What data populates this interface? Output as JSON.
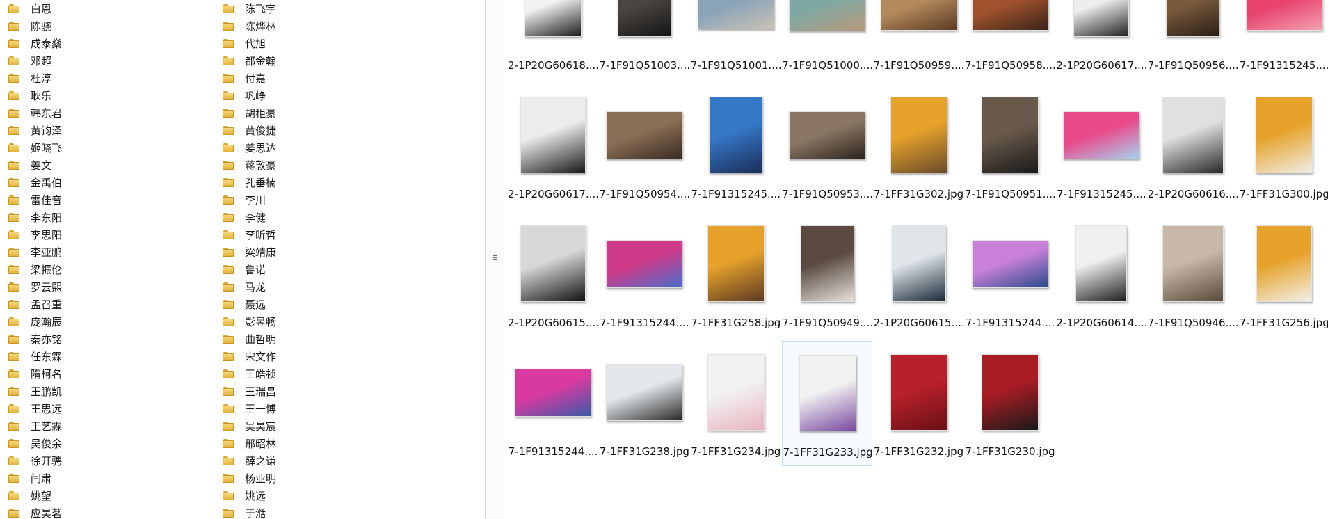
{
  "folders_col1": [
    "白恩",
    "陈骁",
    "成泰燊",
    "邓超",
    "杜淳",
    "耿乐",
    "韩东君",
    "黄钧泽",
    "姬晓飞",
    "姜文",
    "金禹伯",
    "雷佳音",
    "李东阳",
    "李思阳",
    "李亚鹏",
    "梁振伦",
    "罗云熙",
    "孟召重",
    "庞瀚辰",
    "秦亦铭",
    "任东霖",
    "隋柯名",
    "王鹏凯",
    "王思远",
    "王艺霖",
    "吴俊余",
    "徐开骋",
    "闫肃",
    "姚望",
    "应昊茗"
  ],
  "folders_col2": [
    "陈飞宇",
    "陈烨林",
    "代旭",
    "都金翰",
    "付嘉",
    "巩峥",
    "胡秬豪",
    "黄俊捷",
    "姜思达",
    "蒋敦豪",
    "孔垂楠",
    "李川",
    "李健",
    "李昕哲",
    "梁靖康",
    "鲁诺",
    "马龙",
    "聂远",
    "彭昱畅",
    "曲哲明",
    "宋文作",
    "王皓祯",
    "王瑞昌",
    "王一博",
    "吴昊宸",
    "邢昭林",
    "薛之谦",
    "杨业明",
    "姚远",
    "于湉"
  ],
  "files": [
    {
      "name": "2-1P20G60618....",
      "colors": [
        "#f2f2f2",
        "#1c1c1c"
      ]
    },
    {
      "name": "7-1F91Q51003....",
      "colors": [
        "#4a4540",
        "#151515"
      ]
    },
    {
      "name": "7-1F91Q51001....",
      "colors": [
        "#8aa3b8",
        "#c9c2b6"
      ]
    },
    {
      "name": "7-1F91Q51000....",
      "colors": [
        "#7fa8a3",
        "#b79a7c"
      ]
    },
    {
      "name": "7-1F91Q50959....",
      "colors": [
        "#b38a5c",
        "#5c3a24"
      ]
    },
    {
      "name": "7-1F91Q50958....",
      "colors": [
        "#a0522d",
        "#3a2418"
      ]
    },
    {
      "name": "2-1P20G60617....",
      "colors": [
        "#eeeeee",
        "#222222"
      ]
    },
    {
      "name": "7-1F91Q50956....",
      "colors": [
        "#7a5a3c",
        "#2a1e16"
      ]
    },
    {
      "name": "7-1F91315245....",
      "colors": [
        "#e8446e",
        "#f4a0b0"
      ]
    },
    {
      "name": "2-1P20G60617....",
      "colors": [
        "#ececec",
        "#1a1a1a"
      ]
    },
    {
      "name": "7-1F91Q50954....",
      "colors": [
        "#8a6e55",
        "#3a2b22"
      ]
    },
    {
      "name": "7-1F91315245....",
      "colors": [
        "#3578c8",
        "#1c2e5a"
      ]
    },
    {
      "name": "7-1F91Q50953....",
      "colors": [
        "#8a7663",
        "#2d241e"
      ]
    },
    {
      "name": "7-1FF31G302.jpg",
      "colors": [
        "#e6a22a",
        "#6b4c2a"
      ]
    },
    {
      "name": "7-1F91Q50951....",
      "colors": [
        "#6a5a4c",
        "#1a1a1a"
      ]
    },
    {
      "name": "7-1F91315245....",
      "colors": [
        "#e84a8a",
        "#a7d2f0"
      ]
    },
    {
      "name": "2-1P20G60616....",
      "colors": [
        "#e0e0e0",
        "#2a2a2a"
      ]
    },
    {
      "name": "7-1FF31G300.jpg",
      "colors": [
        "#e6a22a",
        "#f2ece4"
      ]
    },
    {
      "name": "2-1P20G60615....",
      "colors": [
        "#d8d8d8",
        "#111111"
      ]
    },
    {
      "name": "7-1F91315244....",
      "colors": [
        "#d03a8a",
        "#4a6ec8"
      ]
    },
    {
      "name": "7-1FF31G258.jpg",
      "colors": [
        "#e6a22a",
        "#5c3a24"
      ]
    },
    {
      "name": "7-1F91Q50949....",
      "colors": [
        "#5a4a40",
        "#e6e2dc"
      ]
    },
    {
      "name": "2-1P20G60615....",
      "colors": [
        "#dfe5e8",
        "#1a2a3a"
      ]
    },
    {
      "name": "7-1F91315244....",
      "colors": [
        "#c880d8",
        "#2a4a8a"
      ]
    },
    {
      "name": "2-1P20G60614....",
      "colors": [
        "#f0f0f0",
        "#1e1e1e"
      ]
    },
    {
      "name": "7-1F91Q50946....",
      "colors": [
        "#c8b8a8",
        "#5a4a3a"
      ]
    },
    {
      "name": "7-1FF31G256.jpg",
      "colors": [
        "#e6a22a",
        "#f4f0ea"
      ]
    },
    {
      "name": "7-1F91315244....",
      "colors": [
        "#d83aa0",
        "#3a5aa8"
      ]
    },
    {
      "name": "7-1FF31G238.jpg",
      "colors": [
        "#e4e8ec",
        "#2a2a2a"
      ]
    },
    {
      "name": "7-1FF31G234.jpg",
      "colors": [
        "#f2f2f2",
        "#e8b4c0"
      ]
    },
    {
      "name": "7-1FF31G233.jpg",
      "colors": [
        "#f2f2f2",
        "#7a4aa0"
      ]
    },
    {
      "name": "7-1FF31G232.jpg",
      "colors": [
        "#b8202a",
        "#6a1016"
      ]
    },
    {
      "name": "7-1FF31G230.jpg",
      "colors": [
        "#a81c24",
        "#1a1a1a"
      ]
    }
  ],
  "selected_file_index": 30
}
